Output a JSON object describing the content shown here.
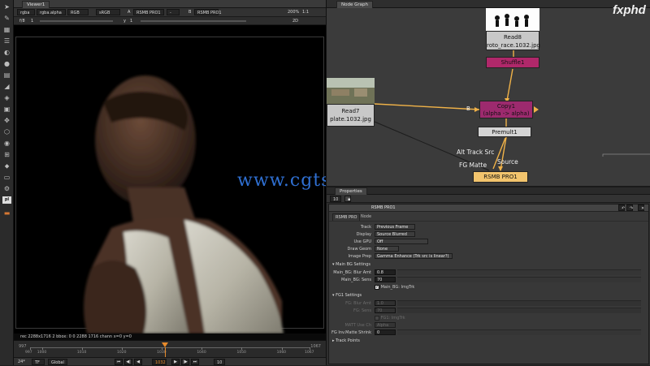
{
  "viewer": {
    "tab": "Viewer1",
    "channels": "rgba",
    "alpha": "rgba.alpha",
    "colorspace": "RGB",
    "lut": "sRGB",
    "input_a": "A",
    "input_a_node": "RSMB PRO1",
    "op": "-",
    "input_b": "B",
    "input_b_node": "RSMB PRO1",
    "zoom": "200%",
    "ratio": "1:1",
    "fstop": "f/8",
    "frame_step": "1",
    "y": "y",
    "y_val": "1",
    "view_mode": "2D",
    "info": "rec 2288x1716 2 bbox: 0 0 2288 1716 chann x=0 y=0"
  },
  "timeline": {
    "start": "997",
    "end": "1067",
    "ticks": [
      "997",
      "1000",
      "1010",
      "1020",
      "1030",
      "1040",
      "1050",
      "1060",
      "1067"
    ],
    "current": "1032",
    "fps": "24*",
    "tf": "TF",
    "scope": "Global",
    "step": "10",
    "buttons": [
      "⏮",
      "◀|",
      "◀",
      "▶",
      "|▶",
      "⏭"
    ]
  },
  "node_graph": {
    "tab": "Node Graph",
    "nodes": {
      "read8": "Read8",
      "read8_file": "roto_race.1032.jpg",
      "shuffle": "Shuffle1",
      "read7": "Read7",
      "read7_file": "plate.1032.jpg",
      "copy": "Copy1",
      "copy_sub": "(alpha -> alpha)",
      "premult": "Premult1",
      "rsmb": "RSMB PRO1"
    },
    "labels": {
      "b_input": "B",
      "alt_track": "Alt Track Src",
      "fg_matte": "FG Matte",
      "source": "Source"
    },
    "colors": {
      "shuffle": "#b0286a",
      "copy": "#9d2a6e",
      "premult": "#d4d4d4",
      "rsmb": "#f2c46d",
      "wire": "#f0b248"
    }
  },
  "properties": {
    "tab": "Properties",
    "count": "10",
    "node_name": "RSMB PRO1",
    "tabs": [
      "RSMB PRO",
      "Node"
    ],
    "fields": {
      "track": {
        "label": "Track",
        "value": "Previous Frame"
      },
      "display": {
        "label": "Display",
        "value": "Source Blurred"
      },
      "gpu": {
        "label": "Use GPU",
        "value": "Off"
      },
      "drawgeom": {
        "label": "Draw Geom",
        "value": "None"
      },
      "imageprep": {
        "label": "Image Prep",
        "value": "Gamma Enhance (Trk src is linear?)"
      }
    },
    "main_bg": {
      "header": "Main BG Settings",
      "blur_label": "Main_BG: Blur Amt",
      "blur_value": "0.8",
      "sens_label": "Main_BG: Sens",
      "sens_value": "70",
      "imgtrk_label": "Main_BG: ImgTrk"
    },
    "fg1": {
      "header": "FG1 Settings",
      "blur_label": "FG: Blur Amt",
      "blur_value": "1.0",
      "sens_label": "FG: Sens",
      "sens_value": "70",
      "imgtrk_label": "FG1: ImgTrk",
      "matt_label": "MATT Use Ch",
      "matt_value": "Alpha",
      "shrink_label": "FG Inv.Matte Shrink",
      "shrink_value": "0"
    },
    "track_points": "Track Points"
  },
  "overlay": {
    "watermark": "www.cgtsj.com",
    "logo": "fxphd"
  },
  "icons": [
    "pointer-icon",
    "paint-icon",
    "grid-icon",
    "layers-icon",
    "sphere-icon",
    "color-icon",
    "stack-icon",
    "filter-icon",
    "keyer-icon",
    "merge-icon",
    "transform-icon",
    "3d-icon",
    "view-icon",
    "metadata-icon",
    "tag-icon",
    "other-icon",
    "plugin-icon",
    "pl-icon",
    "flag-icon"
  ]
}
